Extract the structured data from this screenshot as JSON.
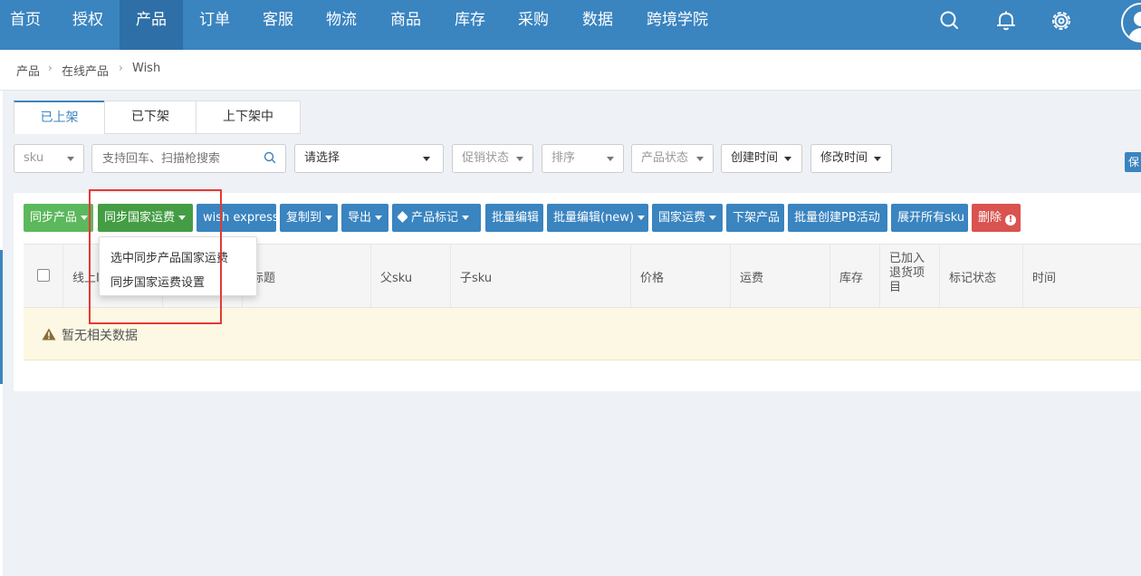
{
  "nav": {
    "items": [
      "首页",
      "授权",
      "产品",
      "订单",
      "客服",
      "物流",
      "商品",
      "库存",
      "采购",
      "数据",
      "跨境学院"
    ],
    "active_index": 2,
    "icons": [
      "search-icon",
      "bell-icon",
      "gear-icon",
      "avatar-icon"
    ]
  },
  "breadcrumb": [
    "产品",
    "在线产品",
    "Wish"
  ],
  "tabs": [
    "已上架",
    "已下架",
    "上下架中"
  ],
  "filters": {
    "sku_select": "sku",
    "search_placeholder": "支持回车、扫描枪搜索",
    "choose_select": "请选择",
    "promo_status": "促销状态",
    "sort": "排序",
    "product_status": "产品状态",
    "create_time": "创建时间",
    "modify_time": "修改时间",
    "save_label": "保"
  },
  "toolbar": {
    "sync_product": "同步产品",
    "sync_country_shipping": "同步国家运费",
    "wish_express": "wish express",
    "copy_to": "复制到",
    "export": "导出",
    "product_mark": "产品标记",
    "batch_edit": "批量编辑",
    "batch_edit_new": "批量编辑(new)",
    "country_shipping": "国家运费",
    "delist_product": "下架产品",
    "batch_create_pb": "批量创建PB活动",
    "expand_all_sku": "展开所有sku",
    "delete": "删除"
  },
  "dropdown": {
    "items": [
      "选中同步产品国家运费",
      "同步国家运费设置"
    ]
  },
  "table": {
    "columns": [
      "线上ID",
      "标题",
      "父sku",
      "子sku",
      "价格",
      "运费",
      "库存",
      "已加入退货项目",
      "标记状态",
      "时间"
    ],
    "col_first_visible": "线上I",
    "col_title_visible": "标题",
    "col_return": "已加入退货项目",
    "empty_text": "暂无相关数据"
  },
  "colors": {
    "nav_bg": "#3a84c0",
    "green": "#5cb85c",
    "blue": "#3a84c0",
    "red": "#d9534f",
    "highlight_box": "#e53935"
  }
}
